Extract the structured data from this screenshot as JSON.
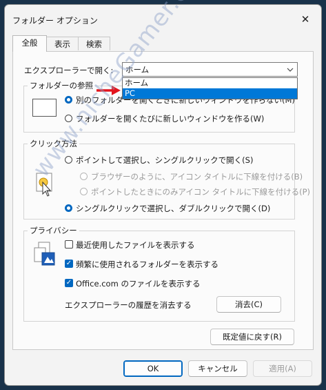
{
  "window": {
    "title": "フォルダー オプション",
    "close_glyph": "✕"
  },
  "tabs": [
    {
      "label": "全般"
    },
    {
      "label": "表示"
    },
    {
      "label": "検索"
    }
  ],
  "explorer_open": {
    "label": "エクスプローラーで開く:",
    "selected": "ホーム",
    "options": [
      "ホーム",
      "PC"
    ],
    "highlighted": "PC",
    "arrow_color": "#e3141c"
  },
  "folder_browse": {
    "title": "フォルダーの参照",
    "option1": "別のフォルダーを開くときに新しいウィンドウを作らない(M)",
    "option2": "フォルダーを開くたびに新しいウィンドウを作る(W)"
  },
  "click_method": {
    "title": "クリック方法",
    "option1": "ポイントして選択し、シングルクリックで開く(S)",
    "sub1": "ブラウザーのように、アイコン タイトルに下線を付ける(B)",
    "sub2": "ポイントしたときにのみアイコン タイトルに下線を付ける(P)",
    "option2": "シングルクリックで選択し、ダブルクリックで開く(D)"
  },
  "privacy": {
    "title": "プライバシー",
    "check1": "最近使用したファイルを表示する",
    "check2": "頻繁に使用されるフォルダーを表示する",
    "check3": "Office.com のファイルを表示する",
    "clear_label": "エクスプローラーの履歴を消去する",
    "clear_button": "消去(C)"
  },
  "restore_defaults": "既定値に戻す(R)",
  "footer": {
    "ok": "OK",
    "cancel": "キャンセル",
    "apply": "適用(A)"
  },
  "watermark": "www.nicheGamer.com",
  "colors": {
    "accent": "#0067c0",
    "highlight": "#0078d7",
    "background": "#19324a"
  }
}
